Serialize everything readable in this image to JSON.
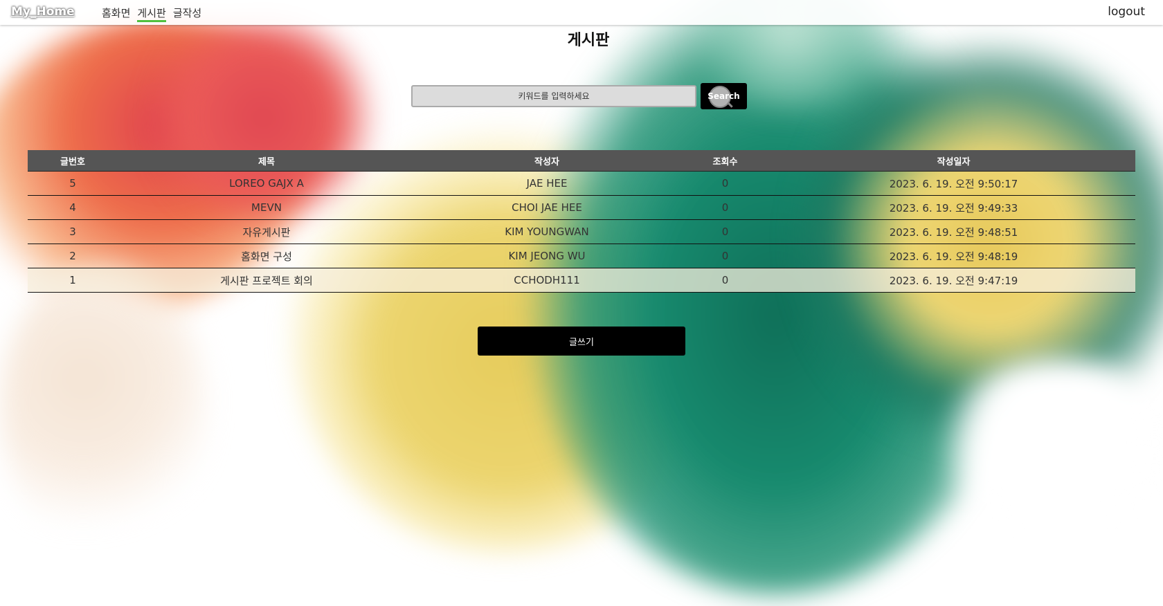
{
  "navbar": {
    "brand": "My_Home",
    "links": [
      {
        "label": "홈화면",
        "active": false
      },
      {
        "label": "게시판",
        "active": true
      },
      {
        "label": "글작성",
        "active": false
      }
    ],
    "logout": "logout"
  },
  "page": {
    "title": "게시판"
  },
  "search": {
    "placeholder": "키워드를 입력하세요",
    "button_label": "Search"
  },
  "table": {
    "headers": [
      "글번호",
      "제목",
      "작성자",
      "조회수",
      "작성일자"
    ],
    "rows": [
      {
        "no": "5",
        "title": "LOREO GAJX A",
        "author": "JAE HEE",
        "views": "0",
        "date": "2023. 6. 19. 오전 9:50:17"
      },
      {
        "no": "4",
        "title": "MEVN",
        "author": "CHOI JAE HEE",
        "views": "0",
        "date": "2023. 6. 19. 오전 9:49:33"
      },
      {
        "no": "3",
        "title": "자유게시판",
        "author": "KIM YOUNGWAN",
        "views": "0",
        "date": "2023. 6. 19. 오전 9:48:51"
      },
      {
        "no": "2",
        "title": "홈화면 구성",
        "author": "KIM JEONG WU",
        "views": "0",
        "date": "2023. 6. 19. 오전 9:48:19"
      },
      {
        "no": "1",
        "title": "게시판 프로젝트 회의",
        "author": "CCHODH111",
        "views": "0",
        "date": "2023. 6. 19. 오전 9:47:19"
      }
    ]
  },
  "actions": {
    "write_label": "글쓰기"
  },
  "colors": {
    "nav_active_underline": "#4fc13e",
    "table_header": "#555555",
    "button": "#000000"
  }
}
